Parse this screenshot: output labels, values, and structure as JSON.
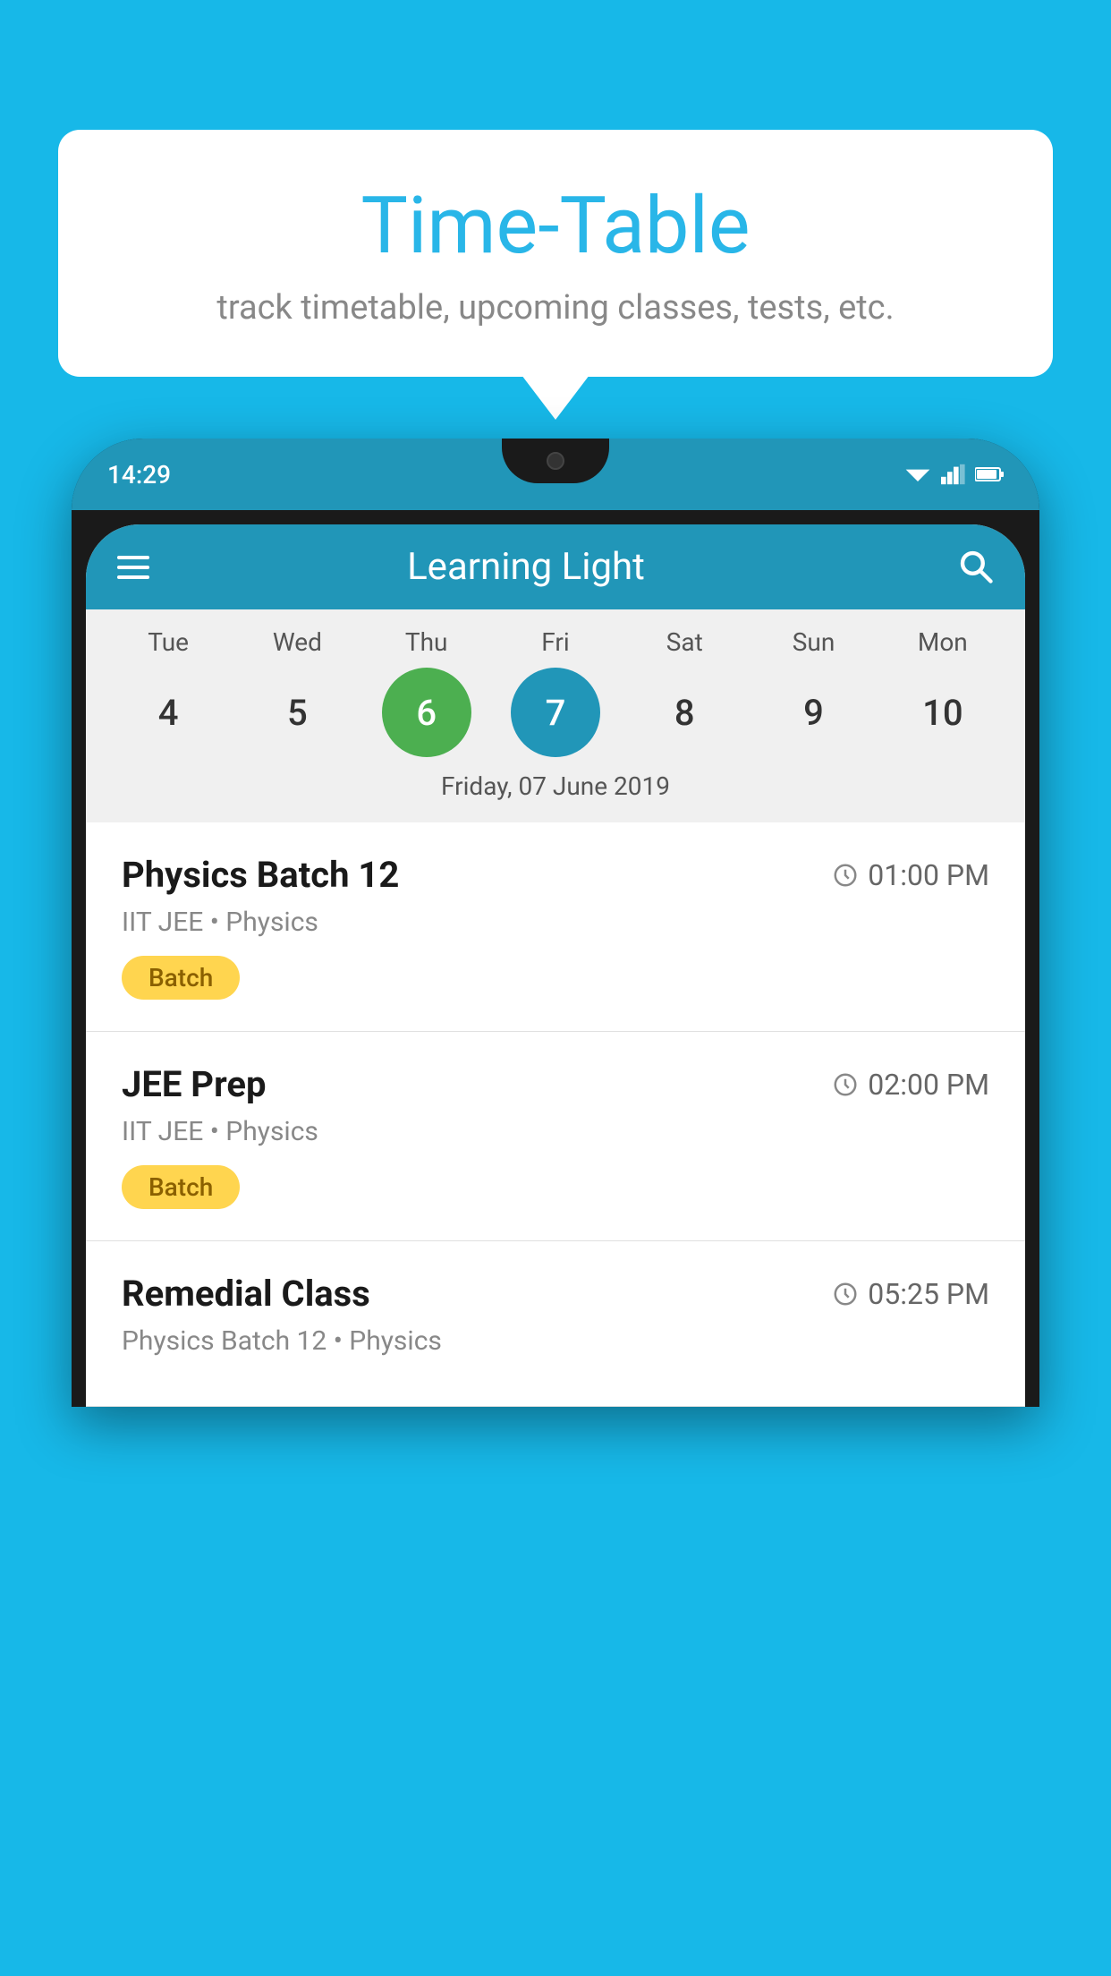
{
  "background_color": "#17b8e8",
  "bubble": {
    "title": "Time-Table",
    "subtitle": "track timetable, upcoming classes, tests, etc."
  },
  "app": {
    "header_title": "Learning Light",
    "status_time": "14:29"
  },
  "calendar": {
    "days": [
      "Tue",
      "Wed",
      "Thu",
      "Fri",
      "Sat",
      "Sun",
      "Mon"
    ],
    "dates": [
      "4",
      "5",
      "6",
      "7",
      "8",
      "9",
      "10"
    ],
    "today_index": 2,
    "selected_index": 3,
    "selected_label": "Friday, 07 June 2019"
  },
  "schedule": [
    {
      "title": "Physics Batch 12",
      "time": "01:00 PM",
      "meta": "IIT JEE • Physics",
      "badge": "Batch"
    },
    {
      "title": "JEE Prep",
      "time": "02:00 PM",
      "meta": "IIT JEE • Physics",
      "badge": "Batch"
    },
    {
      "title": "Remedial Class",
      "time": "05:25 PM",
      "meta": "Physics Batch 12 • Physics",
      "badge": ""
    }
  ],
  "icons": {
    "hamburger": "≡",
    "search": "🔍",
    "clock": "🕐"
  }
}
